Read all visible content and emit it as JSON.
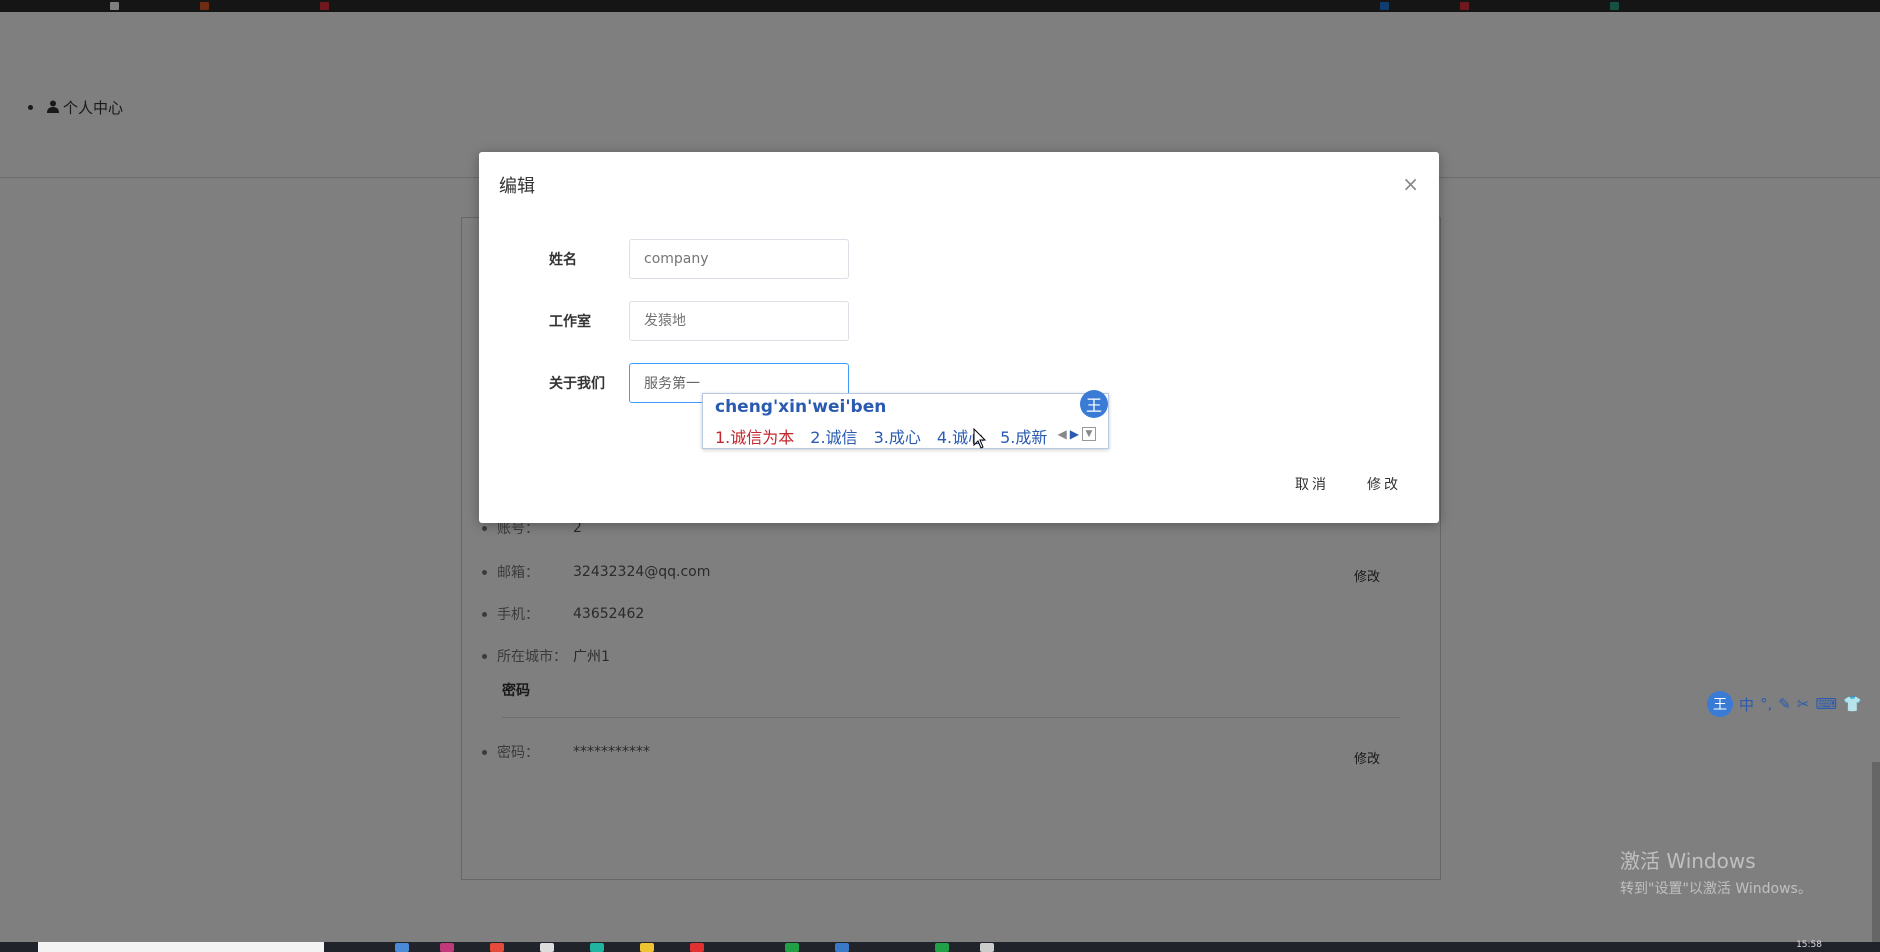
{
  "nav": {
    "personal_center": "个人中心"
  },
  "profile": {
    "rows": [
      {
        "label": "账号：",
        "value": "2"
      },
      {
        "label": "邮箱：",
        "value": "32432324@qq.com"
      },
      {
        "label": "手机：",
        "value": "43652462"
      },
      {
        "label": "所在城市：",
        "value": "广州1"
      }
    ],
    "edit_label": "修改",
    "password_section": "密码",
    "password_row": {
      "label": "密码：",
      "value": "***********"
    }
  },
  "modal": {
    "title": "编辑",
    "close": "×",
    "fields": {
      "name": {
        "label": "姓名",
        "placeholder": "company"
      },
      "studio": {
        "label": "工作室",
        "placeholder": "发猿地"
      },
      "about": {
        "label": "关于我们",
        "value": "服务第一"
      }
    },
    "cancel": "取消",
    "submit": "修改"
  },
  "ime": {
    "pinyin": "cheng'xin'wei'ben",
    "candidates": [
      "1.诚信为本",
      "2.诚信",
      "3.成心",
      "4.诚心",
      "5.成新"
    ],
    "logo": "王"
  },
  "ime_toolbar": {
    "logo": "王",
    "items": [
      "中",
      "°,",
      "✎",
      "✂",
      "⌨",
      "👕"
    ]
  },
  "watermark": {
    "line1": "激活 Windows",
    "line2": "转到\"设置\"以激活 Windows。"
  },
  "taskbar": {
    "clock": "15:58"
  },
  "colors": {
    "accent": "#409eff",
    "ime_blue": "#2a5bb0",
    "ime_selected": "#c1272d",
    "overlay": "rgba(0,0,0,0.5)"
  },
  "icons": {
    "user": "user-icon",
    "close": "close-icon",
    "cursor": "mouse-cursor-icon"
  }
}
